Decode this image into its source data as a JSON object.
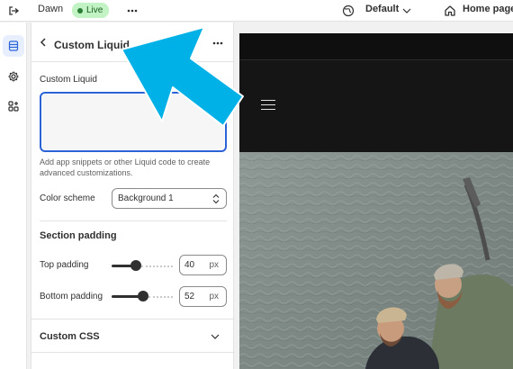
{
  "topbar": {
    "theme_name": "Dawn",
    "status_badge": "Live",
    "locale_label": "Default",
    "page_label": "Home page"
  },
  "rail": {
    "items": [
      "sections",
      "theme-settings",
      "apps"
    ]
  },
  "panel": {
    "title": "Custom Liquid",
    "custom_liquid": {
      "label": "Custom Liquid",
      "value": "",
      "help": "Add app snippets or other Liquid code to create advanced customizations."
    },
    "color_scheme": {
      "label": "Color scheme",
      "value": "Background 1"
    },
    "section_padding": {
      "heading": "Section padding",
      "top": {
        "label": "Top padding",
        "value": "40",
        "unit": "px",
        "fraction": 0.4
      },
      "bottom": {
        "label": "Bottom padding",
        "value": "52",
        "unit": "px",
        "fraction": 0.52
      }
    },
    "custom_css": {
      "label": "Custom CSS"
    }
  },
  "colors": {
    "accent": "#2b63d6",
    "live_badge_bg": "#c2f3c4",
    "annotation_arrow": "#00b1e8",
    "preview_header": "#151515"
  }
}
